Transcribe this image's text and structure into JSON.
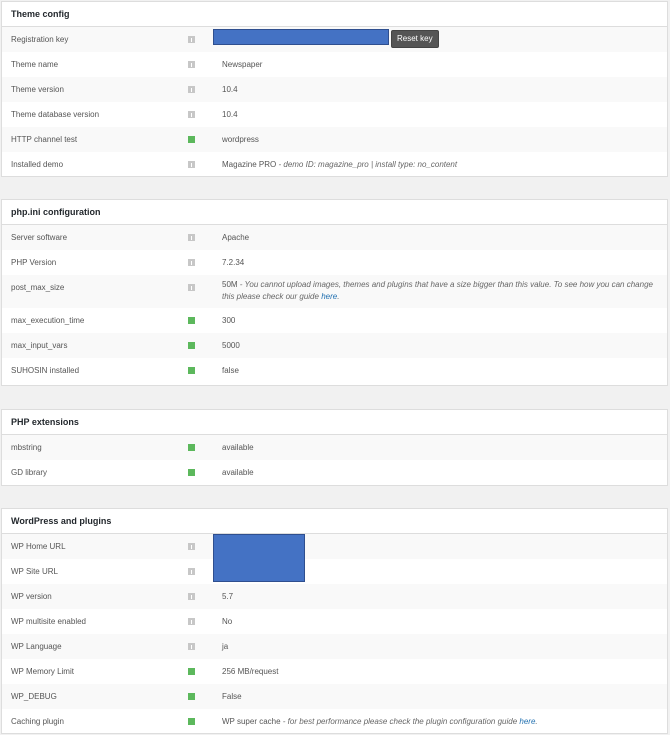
{
  "sections": {
    "theme_config": {
      "title": "Theme config",
      "rows": [
        {
          "label": "Registration key",
          "status": "info",
          "value": "",
          "button": "Reset key"
        },
        {
          "label": "Theme name",
          "status": "info",
          "value": "Newspaper"
        },
        {
          "label": "Theme version",
          "status": "info",
          "value": "10.4"
        },
        {
          "label": "Theme database version",
          "status": "info",
          "value": "10.4"
        },
        {
          "label": "HTTP channel test",
          "status": "ok",
          "value": "wordpress"
        },
        {
          "label": "Installed demo",
          "status": "info",
          "value": "Magazine PRO",
          "note": "- demo ID: magazine_pro | install type: no_content"
        }
      ]
    },
    "php_ini": {
      "title": "php.ini configuration",
      "rows": [
        {
          "label": "Server software",
          "status": "info",
          "value": "Apache"
        },
        {
          "label": "PHP Version",
          "status": "info",
          "value": "7.2.34"
        },
        {
          "label": "post_max_size",
          "status": "info",
          "value": "50M",
          "note": "- You cannot upload images, themes and plugins that have a size bigger than this value. To see how you can change this please check our guide",
          "link": "here",
          "suffix": "."
        },
        {
          "label": "max_execution_time",
          "status": "ok",
          "value": "300"
        },
        {
          "label": "max_input_vars",
          "status": "ok",
          "value": "5000"
        },
        {
          "label": "SUHOSIN installed",
          "status": "ok",
          "value": "false"
        }
      ]
    },
    "php_extensions": {
      "title": "PHP extensions",
      "rows": [
        {
          "label": "mbstring",
          "status": "ok",
          "value": "available"
        },
        {
          "label": "GD library",
          "status": "ok",
          "value": "available"
        }
      ]
    },
    "wp_plugins": {
      "title": "WordPress and plugins",
      "rows": [
        {
          "label": "WP Home URL",
          "status": "info",
          "value": ""
        },
        {
          "label": "WP Site URL",
          "status": "info",
          "value": ""
        },
        {
          "label": "WP version",
          "status": "info",
          "value": "5.7"
        },
        {
          "label": "WP multisite enabled",
          "status": "info",
          "value": "No"
        },
        {
          "label": "WP Language",
          "status": "info",
          "value": "ja"
        },
        {
          "label": "WP Memory Limit",
          "status": "ok",
          "value": "256 MB/request"
        },
        {
          "label": "WP_DEBUG",
          "status": "ok",
          "value": "False"
        },
        {
          "label": "Caching plugin",
          "status": "ok",
          "value": "WP super cache",
          "note": "- for best performance please check the plugin configuration guide",
          "link": "here",
          "suffix": "."
        }
      ]
    }
  },
  "colors": {
    "ok": "#5cb85c",
    "info": "#c7c7c7",
    "redaction": "#4472c4",
    "link": "#2271b1"
  }
}
